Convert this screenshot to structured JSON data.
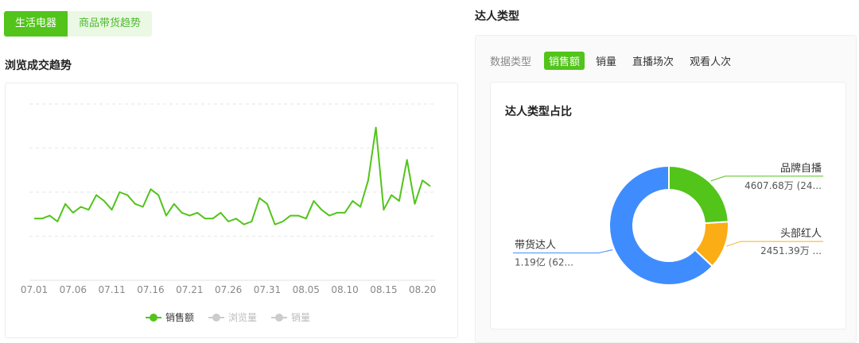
{
  "category_tabs": [
    {
      "label": "生活电器",
      "active": true
    },
    {
      "label": "商品带货趋势",
      "active": false
    }
  ],
  "trend": {
    "title": "浏览成交趋势",
    "legend": [
      {
        "label": "销售额",
        "active": true
      },
      {
        "label": "浏览量",
        "active": false
      },
      {
        "label": "销量",
        "active": false
      }
    ]
  },
  "talent": {
    "title": "达人类型",
    "metric_label": "数据类型",
    "metric_tabs": [
      {
        "label": "销售额",
        "active": true
      },
      {
        "label": "销量",
        "active": false
      },
      {
        "label": "直播场次",
        "active": false
      },
      {
        "label": "观看人次",
        "active": false
      }
    ],
    "donut_title": "达人类型占比"
  },
  "colors": {
    "accent": "#52c41a",
    "blue": "#3f8cff",
    "orange": "#faad14"
  },
  "chart_data": [
    {
      "type": "line",
      "title": "浏览成交趋势",
      "x_tick_labels": [
        "07.01",
        "07.06",
        "07.11",
        "07.16",
        "07.21",
        "07.26",
        "07.31",
        "08.05",
        "08.10",
        "08.15",
        "08.20"
      ],
      "series": [
        {
          "name": "销售额",
          "color": "#52c41a",
          "values": [
            21,
            21,
            22,
            20,
            26,
            23,
            25,
            24,
            29,
            27,
            24,
            30,
            29,
            26,
            25,
            31,
            29,
            22,
            26,
            23,
            22,
            23,
            21,
            21,
            23,
            20,
            21,
            19,
            20,
            28,
            26,
            19,
            20,
            22,
            22,
            21,
            27,
            24,
            22,
            23,
            23,
            27,
            25,
            34,
            52,
            24,
            29,
            27,
            41,
            26,
            34,
            32
          ]
        }
      ],
      "ylim": [
        0,
        60
      ],
      "grid": true,
      "legend": "bottom"
    },
    {
      "type": "pie",
      "title": "达人类型占比",
      "slices": [
        {
          "name": "品牌自播",
          "value_label": "4607.68万 (24...",
          "percent": 24,
          "color": "#52c41a"
        },
        {
          "name": "头部红人",
          "value_label": "2451.39万 ...",
          "percent": 13,
          "color": "#faad14"
        },
        {
          "name": "带货达人",
          "value_label": "1.19亿 (62...",
          "percent": 63,
          "color": "#3f8cff"
        }
      ]
    }
  ]
}
